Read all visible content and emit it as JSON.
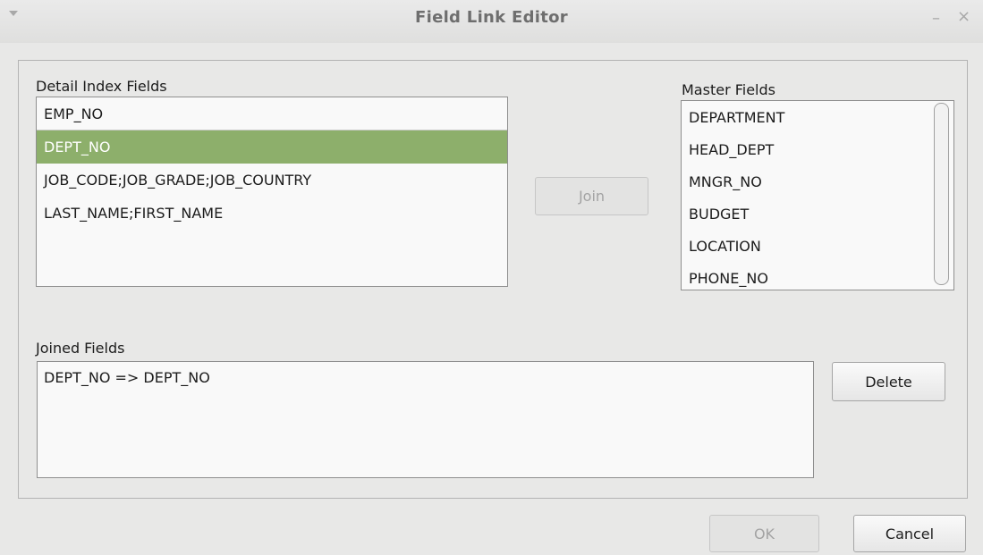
{
  "window": {
    "title": "Field Link Editor",
    "minimize_glyph": "–",
    "close_glyph": "×"
  },
  "detail": {
    "label": "Detail Index Fields",
    "items": [
      "EMP_NO",
      "DEPT_NO",
      "JOB_CODE;JOB_GRADE;JOB_COUNTRY",
      "LAST_NAME;FIRST_NAME"
    ],
    "selected": "DEPT_NO"
  },
  "master": {
    "label": "Master Fields",
    "items": [
      "DEPARTMENT",
      "HEAD_DEPT",
      "MNGR_NO",
      "BUDGET",
      "LOCATION",
      "PHONE_NO"
    ]
  },
  "join_button": {
    "label": "Join",
    "enabled": false
  },
  "joined": {
    "label": "Joined Fields",
    "items": [
      "DEPT_NO => DEPT_NO"
    ]
  },
  "delete_button": {
    "label": "Delete"
  },
  "footer": {
    "ok_label": "OK",
    "ok_enabled": false,
    "cancel_label": "Cancel"
  },
  "colors": {
    "selection": "#8daf6b",
    "disabled_text": "#a3a3a3"
  }
}
